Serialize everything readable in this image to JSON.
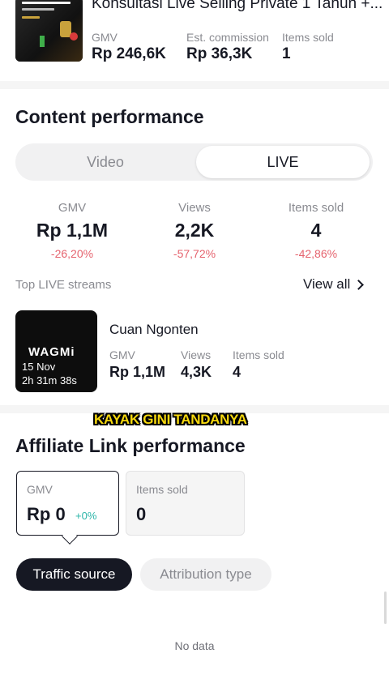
{
  "product": {
    "title": "Konsultasi Live Selling Private 1 Tahun +...",
    "stats": [
      {
        "label": "GMV",
        "value": "Rp 246,6K"
      },
      {
        "label": "Est. commission",
        "value": "Rp 36,3K"
      },
      {
        "label": "Items sold",
        "value": "1"
      }
    ]
  },
  "content_performance": {
    "title": "Content performance",
    "tabs": {
      "video": "Video",
      "live": "LIVE"
    },
    "selected_tab": "LIVE",
    "metrics": [
      {
        "label": "GMV",
        "value": "Rp 1,1M",
        "change": "-26,20%"
      },
      {
        "label": "Views",
        "value": "2,2K",
        "change": "-57,72%"
      },
      {
        "label": "Items sold",
        "value": "4",
        "change": "-42,86%"
      }
    ],
    "top_streams_label": "Top LIVE streams",
    "view_all": "View all"
  },
  "live_stream": {
    "brand": "WAGMi",
    "date": "15 Nov",
    "duration": "2h 31m 38s",
    "name": "Cuan Ngonten",
    "stats": [
      {
        "label": "GMV",
        "value": "Rp 1,1M"
      },
      {
        "label": "Views",
        "value": "4,3K"
      },
      {
        "label": "Items sold",
        "value": "4"
      }
    ]
  },
  "caption": "KAYAK GINI TANDANYA",
  "affiliate": {
    "title": "Affiliate Link performance",
    "gmv": {
      "label": "GMV",
      "value": "Rp 0",
      "change": "+0%"
    },
    "items": {
      "label": "Items sold",
      "value": "0"
    },
    "chips": {
      "active": "Traffic source",
      "inactive": "Attribution type"
    },
    "empty": "No data"
  },
  "colors": {
    "negative": "#e5636e",
    "positive": "#2bb5a8",
    "caption": "#f6d80f",
    "dark": "#161823"
  }
}
